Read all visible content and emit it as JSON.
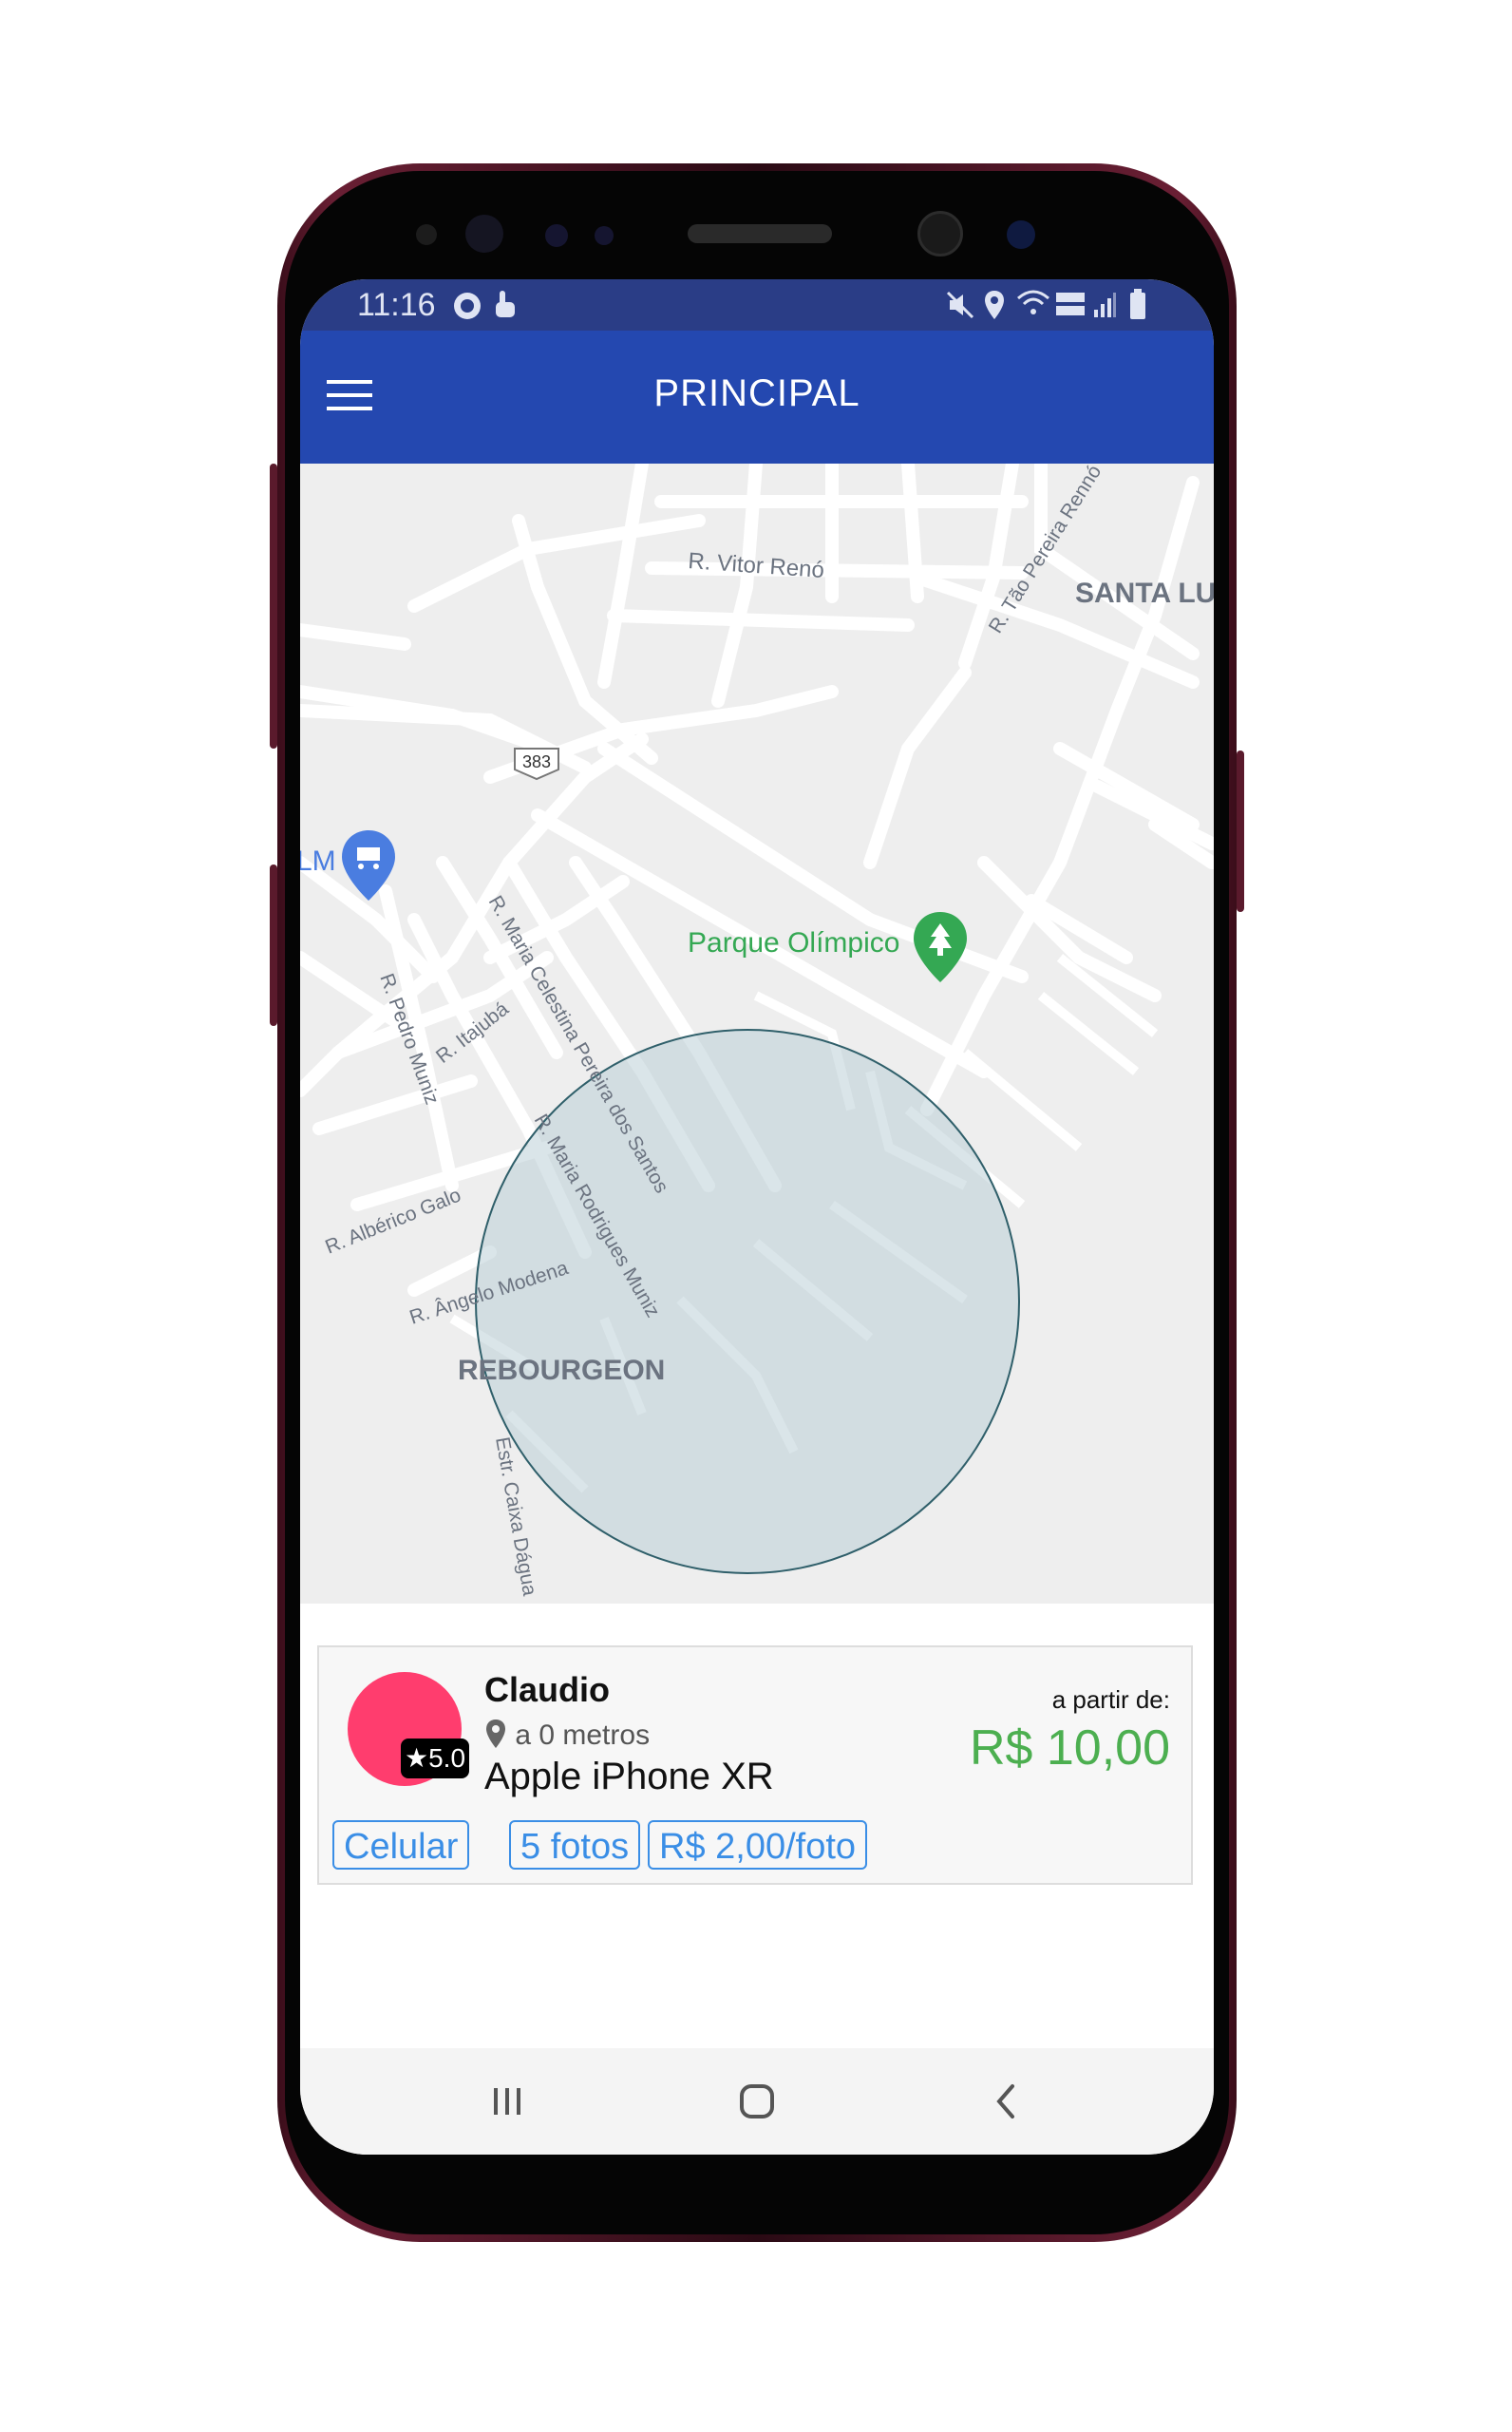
{
  "status_bar": {
    "time": "11:16"
  },
  "app_bar": {
    "title": "PRINCIPAL"
  },
  "map": {
    "labels": {
      "street_vitor_reno": "R. Vitor Renó",
      "street_tao_pereira_reno": "R. Tão Pereira Rennó",
      "area_santa_lu": "SANTA LU",
      "route_383": "383",
      "poi_lm": "LM",
      "park": "Parque Olímpico",
      "street_maria_celestina": "R. Maria Celestina Pereira dos Santos",
      "street_itajuba": "R. Itajubá",
      "street_pedro_muniz": "R. Pedro Muniz",
      "street_maria_rodrigues": "R. Maria Rodrigues Muniz",
      "street_alberico_galo": "R. Albérico Galo",
      "street_angelo_modena": "R. Ângelo Modena",
      "area_rebourgeon": "REBOURGEON",
      "street_caixa_dagua": "Estr. Caixa Dágua"
    }
  },
  "listing": {
    "rating": "★5.0",
    "user_name": "Claudio",
    "distance": "a 0 metros",
    "product": "Apple iPhone XR",
    "price_label": "a partir de:",
    "price": "R$ 10,00",
    "chips": [
      "Celular",
      "5 fotos",
      "R$ 2,00/foto"
    ]
  },
  "colors": {
    "app_bar": "#2448b0",
    "status_bar": "#2a3d86",
    "price": "#4caf50",
    "chip": "#3a8ee6",
    "avatar": "#ff3d6e",
    "park_label": "#34a853"
  },
  "icons": {
    "menu": "hamburger-menu-icon",
    "location": "location-pin-icon",
    "recents": "recents-icon",
    "home": "home-icon",
    "back": "back-icon"
  }
}
